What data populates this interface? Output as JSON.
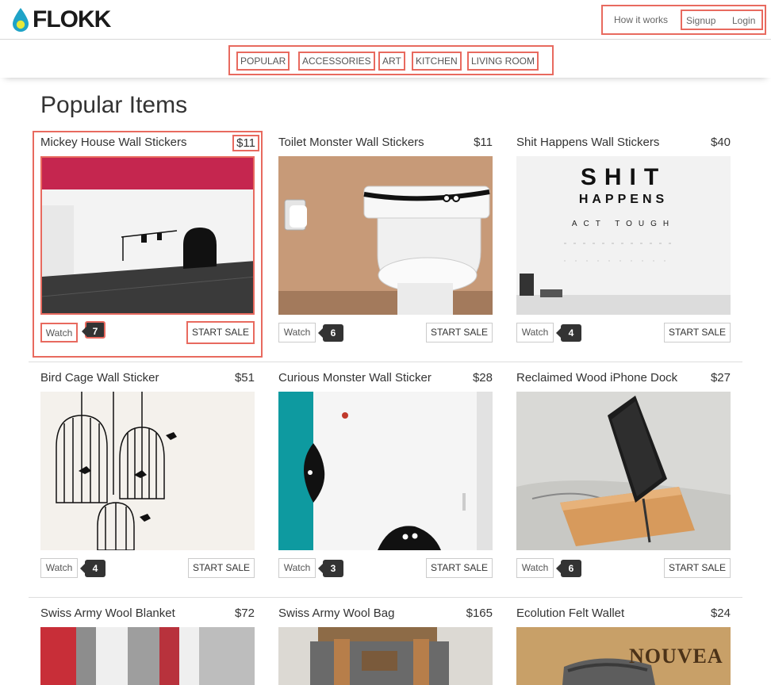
{
  "header": {
    "brand": "FLOKK",
    "links": {
      "how": "How it works",
      "signup": "Signup",
      "login": "Login"
    }
  },
  "categories": [
    "POPULAR",
    "ACCESSORIES",
    "ART",
    "KITCHEN",
    "LIVING ROOM"
  ],
  "page_title": "Popular Items",
  "items": [
    {
      "name": "Mickey House Wall Stickers",
      "price": "$11",
      "watch_label": "Watch",
      "watch_count": "7",
      "action_label": "START SALE"
    },
    {
      "name": "Toilet Monster Wall Stickers",
      "price": "$11",
      "watch_label": "Watch",
      "watch_count": "6",
      "action_label": "START SALE"
    },
    {
      "name": "Shit Happens Wall Stickers",
      "price": "$40",
      "watch_label": "Watch",
      "watch_count": "4",
      "action_label": "START SALE",
      "image_text": {
        "line1": "SHIT",
        "line2": "HAPPENS",
        "line3": "ACT TOUGH"
      }
    },
    {
      "name": "Bird Cage Wall Sticker",
      "price": "$51",
      "watch_label": "Watch",
      "watch_count": "4",
      "action_label": "START SALE"
    },
    {
      "name": "Curious Monster Wall Sticker",
      "price": "$28",
      "watch_label": "Watch",
      "watch_count": "3",
      "action_label": "START SALE"
    },
    {
      "name": "Reclaimed Wood iPhone Dock",
      "price": "$27",
      "watch_label": "Watch",
      "watch_count": "6",
      "action_label": "START SALE"
    },
    {
      "name": "Swiss Army Wool Blanket",
      "price": "$72"
    },
    {
      "name": "Swiss Army Wool Bag",
      "price": "$165"
    },
    {
      "name": "Ecolution Felt Wallet",
      "price": "$24",
      "image_text": {
        "line1": "NOUVEA"
      }
    }
  ],
  "colors": {
    "highlight": "#e86a5f",
    "logo_drop": "#1fa3c7",
    "logo_dot": "#e7e83a"
  }
}
